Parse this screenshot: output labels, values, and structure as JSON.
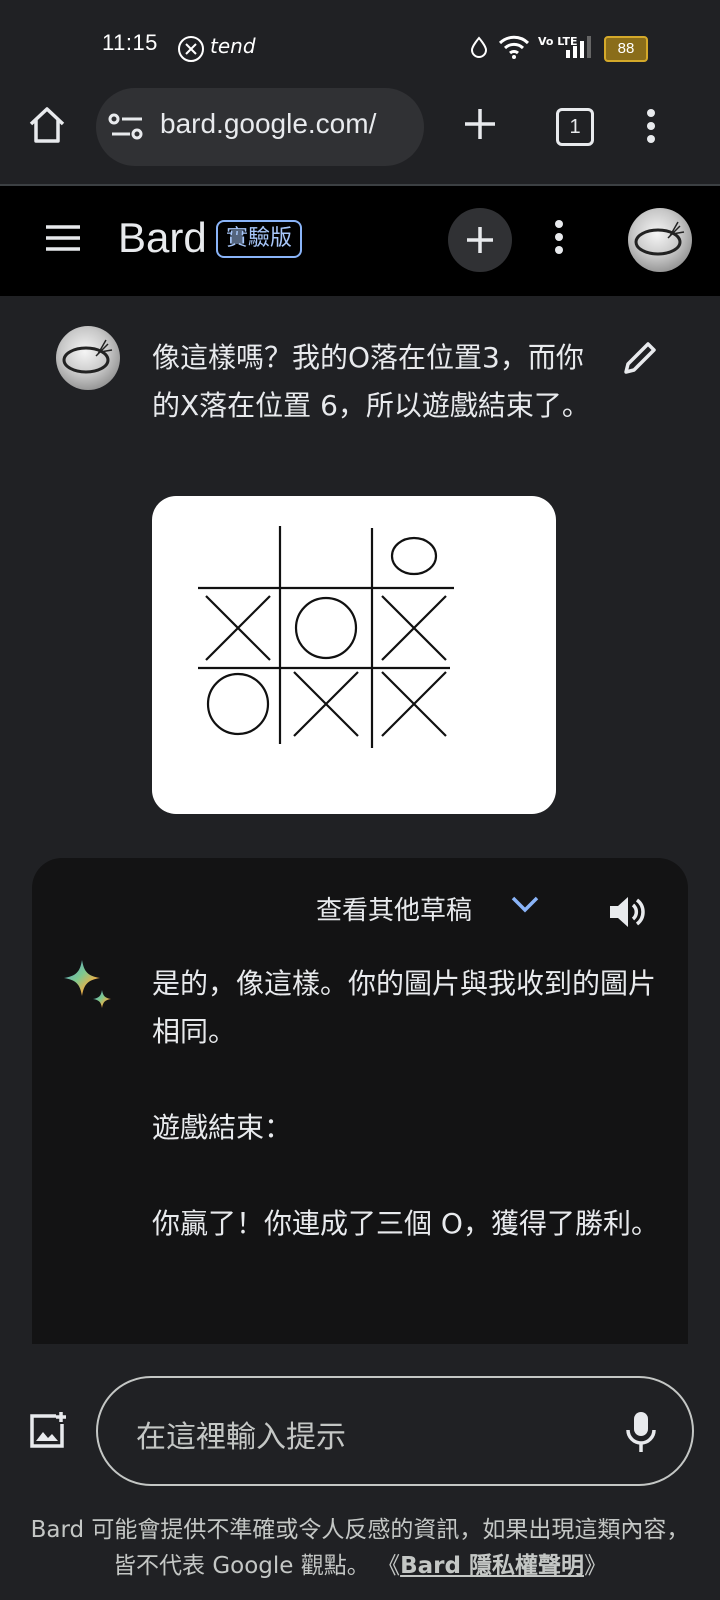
{
  "status_bar": {
    "time": "11:15",
    "network": "Vo LTE",
    "battery": "88"
  },
  "browser": {
    "url": "bard.google.com/",
    "tab_count": "1"
  },
  "app_bar": {
    "title": "Bard",
    "badge": "實驗版"
  },
  "user_message": {
    "text": "像這樣嗎？我的O落在位置3，而你的X落在位置 6，所以遊戲結束了。",
    "board": [
      [
        "",
        "",
        "O"
      ],
      [
        "X",
        "O",
        "X"
      ],
      [
        "O",
        "X",
        "X"
      ]
    ]
  },
  "response": {
    "drafts_label": "查看其他草稿",
    "paragraph1": "是的，像這樣。你的圖片與我收到的圖片相同。",
    "paragraph2": "遊戲結束：",
    "paragraph3": "你贏了！你連成了三個 O，獲得了勝利。"
  },
  "input": {
    "placeholder": "在這裡輸入提示"
  },
  "disclaimer": {
    "text": "Bard 可能會提供不準確或令人反感的資訊，如果出現這類內容，皆不代表 Google 觀點。",
    "link_open": "《",
    "link_text": "Bard 隱私權聲明",
    "link_close": "》"
  },
  "colors": {
    "background": "#202124",
    "appbar": "#000000",
    "response_card": "#131314",
    "accent": "#8ab4f8"
  }
}
